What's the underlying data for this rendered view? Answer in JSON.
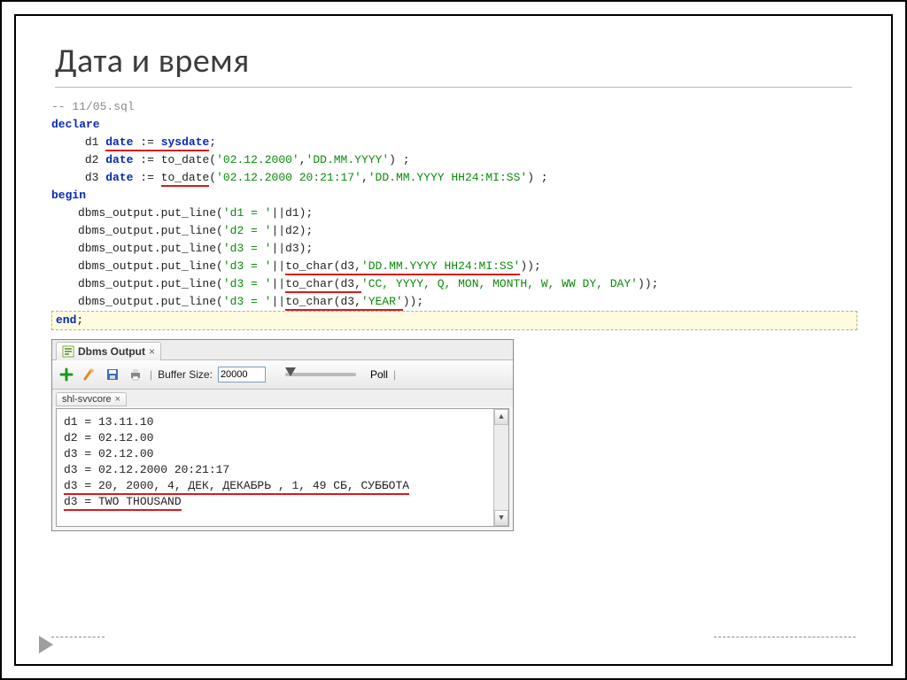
{
  "title": "Дата и время",
  "code": {
    "comment": "-- 11/05.sql",
    "declare": "declare",
    "d1_var": "d1",
    "d2_var": "d2",
    "d3_var": "d3",
    "date_kw": "date",
    "assign": ":=",
    "sysdate": "sysdate",
    "to_date": "to_date",
    "d2_args": "('02.12.2000','DD.MM.YYYY') ;",
    "d2_s1": "'02.12.2000'",
    "d2_s2": "'DD.MM.YYYY'",
    "d3_args": "('02.12.2000 20:21:17','DD.MM.YYYY HH24:MI:SS') ;",
    "d3_s1": "'02.12.2000 20:21:17'",
    "d3_s2": "'DD.MM.YYYY HH24:MI:SS'",
    "begin": "begin",
    "putline": "dbms_output.put_line",
    "p1": "('d1 = '||d1);",
    "p1_s": "'d1 = '",
    "p1_v": "||d1);",
    "p2": "('d2 = '||d2);",
    "p2_s": "'d2 = '",
    "p2_v": "||d2);",
    "p3": "('d3 = '||d3);",
    "p3_s": "'d3 = '",
    "p3_v": "||d3);",
    "p4_prefix": "(",
    "p4_s": "'d3 = '",
    "p4_mid": "||",
    "to_char": "to_char",
    "p4_args": "(d3,'DD.MM.YYYY HH24:MI:SS'",
    "p4_arg1": "(d3,",
    "p4_fmt": "'DD.MM.YYYY HH24:MI:SS'",
    "p4_close": "));",
    "p5_fmt": "'CC, YYYY, Q, MON, MONTH, W, WW DY, DAY'",
    "p6_fmt": "'YEAR'",
    "end": "end",
    "semicolon": ";"
  },
  "dbms": {
    "tab_title": "Dbms Output",
    "toolbar": {
      "buffer_label": "Buffer Size:",
      "buffer_value": "20000",
      "poll_label": "Poll"
    },
    "conn_tab": "shl-svvcore",
    "lines": [
      "d1 = 13.11.10",
      "d2 = 02.12.00",
      "d3 = 02.12.00",
      "d3 = 02.12.2000 20:21:17",
      "d3 = 20, 2000, 4, ДЕК, ДЕКАБРЬ , 1, 49 СБ, СУББОТА",
      "d3 = TWO THOUSAND"
    ]
  }
}
